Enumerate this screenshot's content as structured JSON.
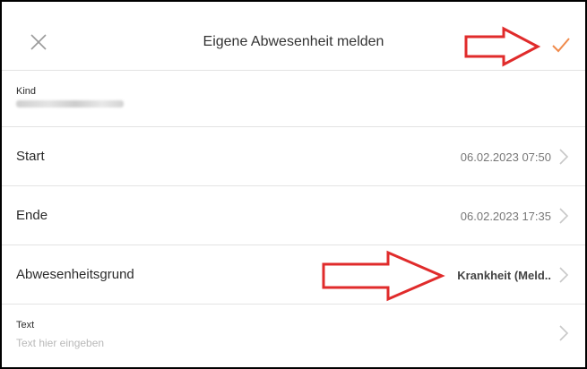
{
  "header": {
    "title": "Eigene Abwesenheit melden",
    "close_icon": "close-icon",
    "save_icon": "checkmark-icon",
    "accent_color": "#f08a4b"
  },
  "form": {
    "kind": {
      "label": "Kind"
    },
    "start": {
      "label": "Start",
      "value": "06.02.2023 07:50"
    },
    "ende": {
      "label": "Ende",
      "value": "06.02.2023 17:35"
    },
    "grund": {
      "label": "Abwesenheitsgrund",
      "value": "Krankheit (Meld.."
    },
    "text": {
      "label": "Text",
      "placeholder": "Text hier eingeben"
    }
  },
  "annotations": {
    "arrow_color": "#e02b2b"
  }
}
